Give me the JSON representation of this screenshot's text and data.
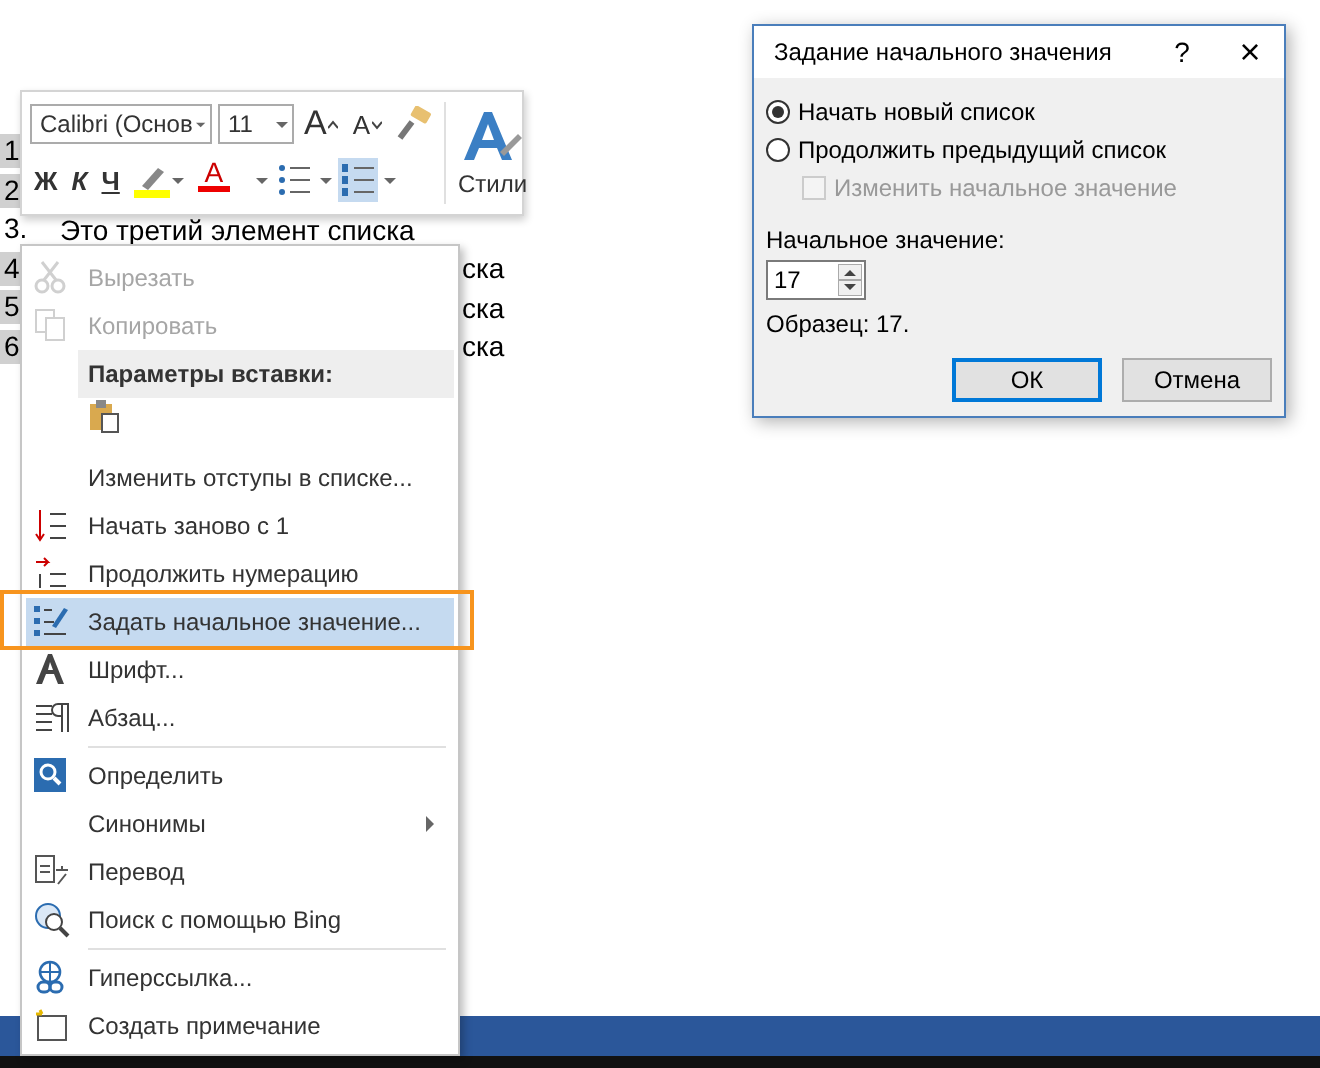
{
  "document": {
    "lines": [
      {
        "number": "1"
      },
      {
        "number": "2"
      },
      {
        "number": "3.",
        "text": "Это третий элемент списка"
      },
      {
        "number": "4",
        "text": "ска"
      },
      {
        "number": "5",
        "text": "ска"
      },
      {
        "number": "6",
        "text": "ска"
      }
    ]
  },
  "mini_toolbar": {
    "font": "Calibri (Основ",
    "size": "11",
    "grow": "A",
    "shrink": "A",
    "bold": "Ж",
    "italic": "К",
    "underline": "Ч",
    "font_color": "A",
    "bullets_selected": false,
    "numbering_selected": true,
    "styles": "Стили"
  },
  "context_menu": {
    "items": [
      {
        "kind": "item",
        "label": "Вырезать",
        "disabled": true,
        "selected": false
      },
      {
        "kind": "item",
        "label": "Копировать",
        "disabled": true,
        "selected": false
      },
      {
        "kind": "header",
        "label": "Параметры вставки:"
      },
      {
        "kind": "paste"
      },
      {
        "kind": "item",
        "label": "Изменить отступы в списке...",
        "disabled": false,
        "selected": false
      },
      {
        "kind": "item",
        "label": "Начать заново с 1",
        "disabled": false,
        "selected": false
      },
      {
        "kind": "item",
        "label": "Продолжить нумерацию",
        "disabled": false,
        "selected": false
      },
      {
        "kind": "item",
        "label": "Задать начальное значение...",
        "disabled": false,
        "selected": true
      },
      {
        "kind": "item",
        "label": "Шрифт...",
        "disabled": false,
        "selected": false
      },
      {
        "kind": "item",
        "label": "Абзац...",
        "disabled": false,
        "selected": false
      },
      {
        "kind": "separator"
      },
      {
        "kind": "item",
        "label": "Определить",
        "disabled": false,
        "selected": false
      },
      {
        "kind": "submenu",
        "label": "Синонимы",
        "disabled": false,
        "selected": false
      },
      {
        "kind": "item",
        "label": "Перевод",
        "disabled": false,
        "selected": false
      },
      {
        "kind": "item",
        "label": "Поиск с помощью Bing",
        "disabled": false,
        "selected": false
      },
      {
        "kind": "separator"
      },
      {
        "kind": "item",
        "label": "Гиперссылка...",
        "disabled": false,
        "selected": false
      },
      {
        "kind": "item",
        "label": "Создать примечание",
        "disabled": false,
        "selected": false
      }
    ]
  },
  "dialog": {
    "title": "Задание начального значения",
    "help": "?",
    "close": "×",
    "options": [
      {
        "label": "Начать новый список",
        "selected": true
      },
      {
        "label": "Продолжить предыдущий список",
        "selected": false
      }
    ],
    "checkbox": {
      "label": "Изменить начальное значение",
      "checked": false,
      "disabled": true
    },
    "value_label": "Начальное значение:",
    "value": "17",
    "preview": "Образец: 17.",
    "buttons": [
      {
        "label": "ОК",
        "default": true
      },
      {
        "label": "Отмена",
        "default": false
      }
    ]
  }
}
